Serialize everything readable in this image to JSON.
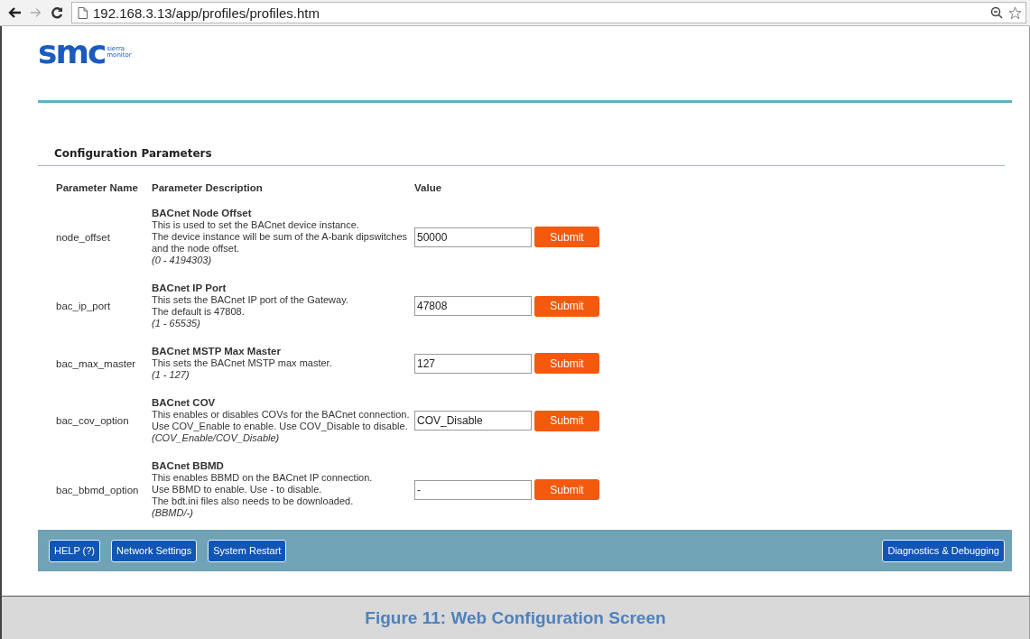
{
  "browser": {
    "url": "192.168.3.13/app/profiles/profiles.htm"
  },
  "logo": {
    "mark": "smc",
    "line1": "sierra",
    "line2": "monitor"
  },
  "section_title": "Configuration Parameters",
  "columns": [
    "Parameter Name",
    "Parameter Description",
    "Value"
  ],
  "parameters": [
    {
      "name": "node_offset",
      "title": "BACnet Node Offset",
      "lines": [
        "This is used to set the BACnet device instance.",
        "The device instance will be sum of the A-bank dipswitches",
        "and the node offset."
      ],
      "range": "(0 - 4194303)",
      "value": "50000",
      "button": "Submit"
    },
    {
      "name": "bac_ip_port",
      "title": "BACnet IP Port",
      "lines": [
        "This sets the BACnet IP port of the Gateway.",
        "The default is 47808."
      ],
      "range": "(1 - 65535)",
      "value": "47808",
      "button": "Submit"
    },
    {
      "name": "bac_max_master",
      "title": "BACnet MSTP Max Master",
      "lines": [
        "This sets the BACnet MSTP max master."
      ],
      "range": "(1 - 127)",
      "value": "127",
      "button": "Submit"
    },
    {
      "name": "bac_cov_option",
      "title": "BACnet COV",
      "lines": [
        "This enables or disables COVs for the BACnet connection.",
        "Use COV_Enable to enable. Use COV_Disable to disable."
      ],
      "range": "(COV_Enable/COV_Disable)",
      "value": "COV_Disable",
      "button": "Submit"
    },
    {
      "name": "bac_bbmd_option",
      "title": "BACnet BBMD",
      "lines": [
        "This enables BBMD on the BACnet IP connection.",
        "Use BBMD to enable. Use - to disable.",
        "The bdt.ini files also needs to be downloaded."
      ],
      "range": "(BBMD/-)",
      "value": "-",
      "button": "Submit"
    }
  ],
  "footer_buttons": {
    "left": [
      "HELP (?)",
      "Network Settings",
      "System Restart"
    ],
    "right": [
      "Diagnostics & Debugging"
    ]
  },
  "caption": "Figure 11: Web Configuration Screen"
}
